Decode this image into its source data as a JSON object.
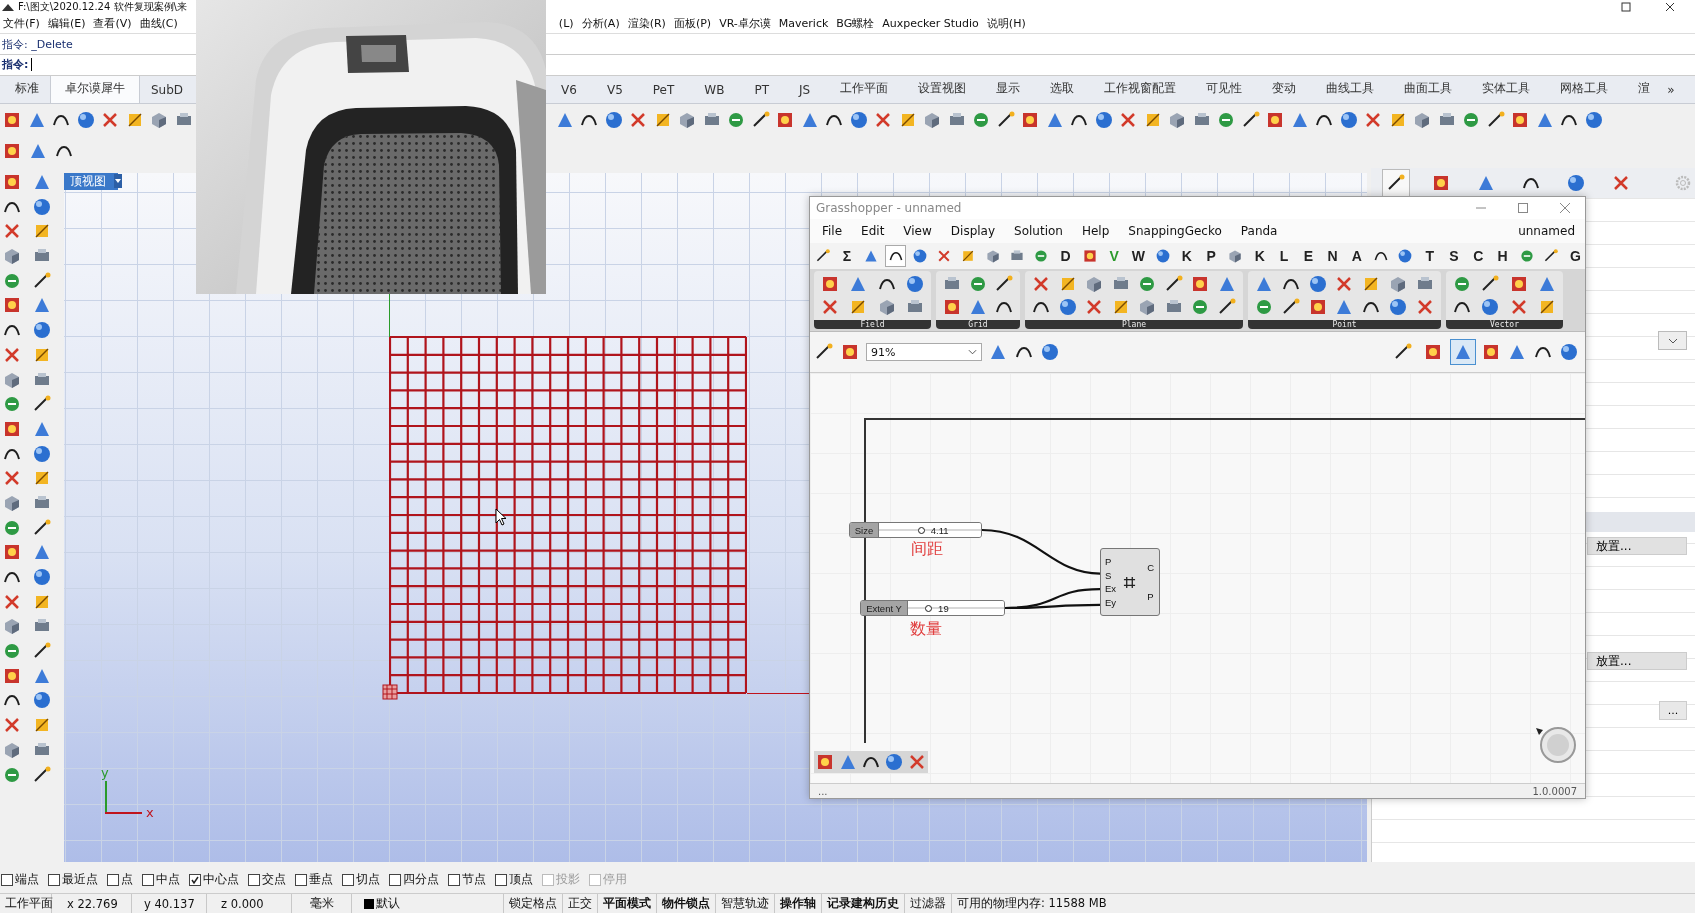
{
  "window": {
    "title": "F:\\图文\\2020.12.24 软件复现案例\\来"
  },
  "menu_left": [
    "文件(F)",
    "编辑(E)",
    "查看(V)",
    "曲线(C)"
  ],
  "menu_right": [
    "(L)",
    "分析(A)",
    "渲染(R)",
    "面板(P)",
    "VR-卓尔谟",
    "Maverick",
    "BG螺栓",
    "Auxpecker Studio",
    "说明(H)"
  ],
  "command": {
    "history": "指令: _Delete",
    "prompt": "指令:"
  },
  "tabs_left": [
    {
      "label": "标准",
      "selected": false
    },
    {
      "label": "卓尔谟犀牛",
      "selected": true
    },
    {
      "label": "SubD",
      "selected": false
    }
  ],
  "tabs_right": [
    {
      "label": "V6",
      "selected": false
    },
    {
      "label": "V5",
      "selected": false
    },
    {
      "label": "PeT",
      "selected": false
    },
    {
      "label": "WB",
      "selected": false
    },
    {
      "label": "PT",
      "selected": false
    },
    {
      "label": "JS",
      "selected": false
    },
    {
      "label": "工作平面",
      "selected": false
    },
    {
      "label": "设置视图",
      "selected": false
    },
    {
      "label": "显示",
      "selected": false
    },
    {
      "label": "选取",
      "selected": false
    },
    {
      "label": "工作视窗配置",
      "selected": false
    },
    {
      "label": "可见性",
      "selected": false
    },
    {
      "label": "变动",
      "selected": false
    },
    {
      "label": "曲线工具",
      "selected": false
    },
    {
      "label": "曲面工具",
      "selected": false
    },
    {
      "label": "实体工具",
      "selected": false
    },
    {
      "label": "网格工具",
      "selected": false
    },
    {
      "label": "渲",
      "selected": false
    }
  ],
  "tabs_more": "»",
  "viewport": {
    "title": "顶视图",
    "axis_y": "y",
    "axis_x": "x"
  },
  "right_panel": {
    "tabs": [
      {
        "selected": true
      },
      {
        "selected": false
      },
      {
        "selected": false
      },
      {
        "selected": false
      },
      {
        "selected": false
      },
      {
        "selected": false
      }
    ],
    "buttons": [
      "放置...",
      "放置..."
    ],
    "more_button": "..."
  },
  "osnaps": [
    {
      "label": "端点",
      "checked": false,
      "disabled": false
    },
    {
      "label": "最近点",
      "checked": false,
      "disabled": false
    },
    {
      "label": "点",
      "checked": false,
      "disabled": false
    },
    {
      "label": "中点",
      "checked": false,
      "disabled": false
    },
    {
      "label": "中心点",
      "checked": true,
      "disabled": false
    },
    {
      "label": "交点",
      "checked": false,
      "disabled": false
    },
    {
      "label": "垂点",
      "checked": false,
      "disabled": false
    },
    {
      "label": "切点",
      "checked": false,
      "disabled": false
    },
    {
      "label": "四分点",
      "checked": false,
      "disabled": false
    },
    {
      "label": "节点",
      "checked": false,
      "disabled": false
    },
    {
      "label": "顶点",
      "checked": false,
      "disabled": false
    },
    {
      "label": "投影",
      "checked": false,
      "disabled": true
    },
    {
      "label": "停用",
      "checked": false,
      "disabled": true
    }
  ],
  "status_bar": [
    {
      "kind": "text",
      "text": "工作平面"
    },
    {
      "kind": "text",
      "text": "x 22.769"
    },
    {
      "kind": "text",
      "text": "y 40.137"
    },
    {
      "kind": "text",
      "text": "z 0.000"
    },
    {
      "kind": "text",
      "text": "毫米"
    },
    {
      "kind": "layer",
      "text": "默认",
      "color": "#000000"
    },
    {
      "kind": "toggle",
      "text": "锁定格点",
      "on": false
    },
    {
      "kind": "toggle",
      "text": "正交",
      "on": false
    },
    {
      "kind": "toggle",
      "text": "平面模式",
      "on": true
    },
    {
      "kind": "toggle",
      "text": "物件锁点",
      "on": true
    },
    {
      "kind": "toggle",
      "text": "智慧轨迹",
      "on": false
    },
    {
      "kind": "toggle",
      "text": "操作轴",
      "on": true
    },
    {
      "kind": "toggle",
      "text": "记录建构历史",
      "on": true
    },
    {
      "kind": "toggle",
      "text": "过滤器",
      "on": false
    },
    {
      "kind": "text",
      "text": "可用的物理内存: 11588 MB"
    }
  ],
  "grasshopper": {
    "title": "Grasshopper - unnamed",
    "menu": [
      "File",
      "Edit",
      "View",
      "Display",
      "Solution",
      "Help",
      "SnappingGecko",
      "Panda"
    ],
    "document_name": "unnamed",
    "tabs": [
      {
        "kind": "icon",
        "selected": false
      },
      {
        "kind": "letter",
        "label": "Σ",
        "selected": false
      },
      {
        "kind": "icon",
        "selected": false
      },
      {
        "kind": "icon",
        "selected": true
      },
      {
        "kind": "icon",
        "selected": false
      },
      {
        "kind": "icon",
        "selected": false
      },
      {
        "kind": "icon",
        "selected": false
      },
      {
        "kind": "icon",
        "selected": false
      },
      {
        "kind": "icon",
        "selected": false
      },
      {
        "kind": "icon",
        "selected": false
      },
      {
        "kind": "letter",
        "label": "D",
        "selected": false
      },
      {
        "kind": "icon",
        "selected": false
      },
      {
        "kind": "letter",
        "label": "V",
        "selected": false,
        "color": "#2a9a2a"
      },
      {
        "kind": "letter",
        "label": "W",
        "selected": false
      },
      {
        "kind": "icon",
        "selected": false
      },
      {
        "kind": "letter",
        "label": "K",
        "selected": false
      },
      {
        "kind": "letter",
        "label": "P",
        "selected": false
      },
      {
        "kind": "icon",
        "selected": false
      },
      {
        "kind": "letter",
        "label": "K",
        "selected": false
      },
      {
        "kind": "letter",
        "label": "L",
        "selected": false
      },
      {
        "kind": "letter",
        "label": "E",
        "selected": false
      },
      {
        "kind": "letter",
        "label": "N",
        "selected": false
      },
      {
        "kind": "letter",
        "label": "A",
        "selected": false
      },
      {
        "kind": "icon",
        "selected": false
      },
      {
        "kind": "icon",
        "selected": false
      },
      {
        "kind": "letter",
        "label": "T",
        "selected": false
      },
      {
        "kind": "letter",
        "label": "S",
        "selected": false
      },
      {
        "kind": "letter",
        "label": "C",
        "selected": false
      },
      {
        "kind": "letter",
        "label": "H",
        "selected": false
      },
      {
        "kind": "icon",
        "selected": false
      },
      {
        "kind": "icon",
        "selected": false
      },
      {
        "kind": "letter",
        "label": "G",
        "selected": false
      }
    ],
    "panels": [
      "Field",
      "Grid",
      "Plane",
      "Point",
      "Vector"
    ],
    "zoom": "91%",
    "display_modes": [
      {
        "selected": false
      },
      {
        "selected": false
      },
      {
        "selected": true
      }
    ],
    "sliders": [
      {
        "label": "Size",
        "value": "4.11",
        "level": 0.42
      },
      {
        "label": "Extent Y",
        "value": "19",
        "level": 0.22
      }
    ],
    "notes": [
      "间距",
      "数量"
    ],
    "component": {
      "inputs": [
        "P",
        "S",
        "Ex",
        "Ey"
      ],
      "outputs": [
        "C",
        "P"
      ]
    },
    "status": "...",
    "version": "1.0.0007"
  }
}
